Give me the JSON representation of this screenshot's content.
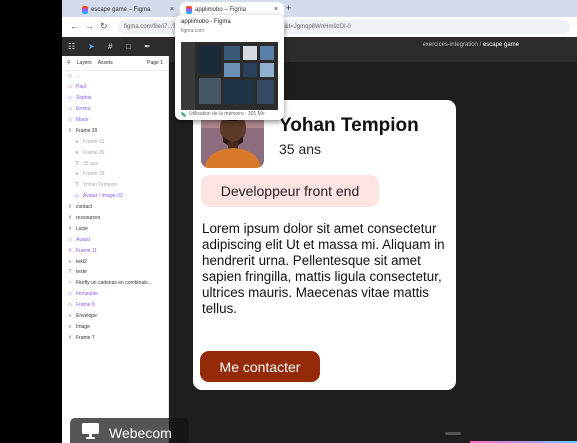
{
  "browser": {
    "tabs": [
      {
        "title": "escape game – Figma",
        "close": "×"
      },
      {
        "title": "applimobo – Figma",
        "close": "×"
      }
    ],
    "new_tab": "+",
    "url": "figma.com/file/i7...?type=design&node-id=0-1&mode=design&t=Jgmqp8WnHm9zDl-0"
  },
  "tab_preview": {
    "title": "applimobo - Figma",
    "host": "figma.com",
    "memory": "Utilisation de la mémoire : 301 Mo"
  },
  "figma": {
    "breadcrumb_project": "exercices-integration",
    "breadcrumb_sep": "/",
    "breadcrumb_file": "escape game",
    "panel_tabs": [
      "Layers",
      "Assets"
    ],
    "page_label": "Page 1",
    "layers": [
      {
        "icon": "◇",
        "label": "...",
        "style": "muted"
      },
      {
        "icon": "◇",
        "label": "Paul",
        "style": "purple"
      },
      {
        "icon": "◇",
        "label": "Sophie",
        "style": "purple"
      },
      {
        "icon": "◇",
        "label": "Emma",
        "style": "purple"
      },
      {
        "icon": "◇",
        "label": "Marie",
        "style": "purple"
      },
      {
        "icon": "#",
        "label": "Frame 29",
        "style": ""
      },
      {
        "icon": "≡",
        "label": "Frame 31",
        "style": "muted",
        "indent": 1
      },
      {
        "icon": "≡",
        "label": "Frame 30",
        "style": "muted",
        "indent": 1
      },
      {
        "icon": "T",
        "label": "35 ans",
        "style": "muted",
        "indent": 1
      },
      {
        "icon": "≡",
        "label": "Frame 28",
        "style": "muted",
        "indent": 1
      },
      {
        "icon": "T",
        "label": "Yohan Tempion",
        "style": "muted",
        "indent": 1
      },
      {
        "icon": "◇",
        "label": "Avatar / Image-03",
        "style": "purple",
        "indent": 1
      },
      {
        "icon": "#",
        "label": "contact",
        "style": ""
      },
      {
        "icon": "#",
        "label": "ressources",
        "style": ""
      },
      {
        "icon": "#",
        "label": "Lucie",
        "style": ""
      },
      {
        "icon": "◇",
        "label": "Avatar",
        "style": "purple"
      },
      {
        "icon": "#",
        "label": "Frame 11",
        "style": "purple"
      },
      {
        "icon": "≡",
        "label": "text2",
        "style": ""
      },
      {
        "icon": "T",
        "label": "texte",
        "style": ""
      },
      {
        "icon": "○",
        "label": "Firefly un cadenas en combinais...",
        "style": ""
      },
      {
        "icon": "◇",
        "label": "Immeuble",
        "style": "purple"
      },
      {
        "icon": "◇",
        "label": "Frame 8",
        "style": "purple"
      },
      {
        "icon": "≡",
        "label": "Envelope",
        "style": ""
      },
      {
        "icon": "≡",
        "label": "Image",
        "style": ""
      },
      {
        "icon": "#",
        "label": "Frame 7",
        "style": ""
      }
    ]
  },
  "card": {
    "name": "Yohan Tempion",
    "age": "35 ans",
    "badge": "Developpeur front end",
    "description": "Lorem ipsum dolor sit amet consectetur adipiscing elit Ut et massa mi. Aliquam in hendrerit urna. Pellentesque sit amet sapien fringilla, mattis ligula consectetur, ultrices mauris. Maecenas vitae mattis tellus.",
    "cta": "Me contacter"
  },
  "watermark": {
    "text": "Webecom"
  },
  "colors": {
    "cta_bg": "#952a09",
    "badge_bg": "#fde4e2",
    "canvas_bg": "#1e1e1e",
    "figma_purple": "#8a5cf6"
  }
}
